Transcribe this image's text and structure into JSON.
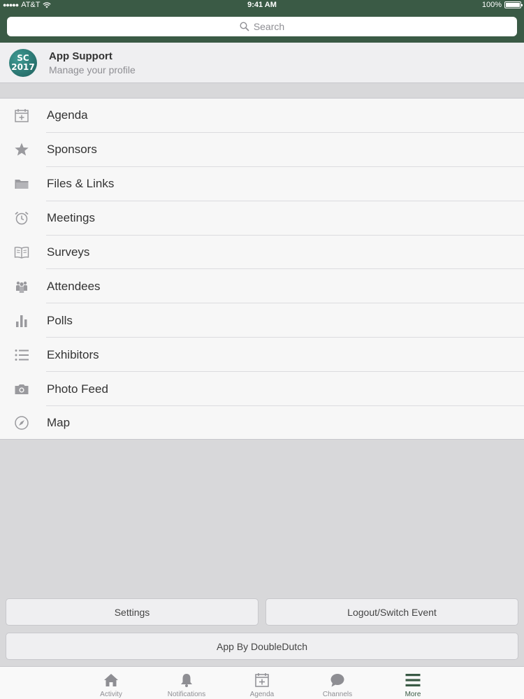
{
  "status_bar": {
    "carrier": "AT&T",
    "time": "9:41 AM",
    "battery": "100%"
  },
  "search": {
    "placeholder": "Search",
    "icon": "search-icon"
  },
  "profile": {
    "avatar_line1": "SC",
    "avatar_line2": "2017",
    "name": "App Support",
    "subtitle": "Manage your profile"
  },
  "menu": {
    "items": [
      {
        "label": "Agenda",
        "icon": "calendar-icon"
      },
      {
        "label": "Sponsors",
        "icon": "star-icon"
      },
      {
        "label": "Files & Links",
        "icon": "folder-icon"
      },
      {
        "label": "Meetings",
        "icon": "alarm-clock-icon"
      },
      {
        "label": "Surveys",
        "icon": "open-book-icon"
      },
      {
        "label": "Attendees",
        "icon": "people-icon"
      },
      {
        "label": "Polls",
        "icon": "bar-chart-icon"
      },
      {
        "label": "Exhibitors",
        "icon": "list-icon"
      },
      {
        "label": "Photo Feed",
        "icon": "camera-icon"
      },
      {
        "label": "Map",
        "icon": "compass-icon"
      }
    ]
  },
  "buttons": {
    "settings": "Settings",
    "logout": "Logout/Switch Event",
    "app_by": "App By DoubleDutch"
  },
  "tabbar": {
    "tabs": [
      {
        "label": "Activity",
        "icon": "home-icon"
      },
      {
        "label": "Notifications",
        "icon": "bell-icon"
      },
      {
        "label": "Agenda",
        "icon": "calendar-icon"
      },
      {
        "label": "Channels",
        "icon": "chat-bubble-icon"
      },
      {
        "label": "More",
        "icon": "hamburger-menu-icon"
      }
    ],
    "active": "More"
  },
  "colors": {
    "header": "#3a5a45",
    "icon_gray": "#9a9a9e",
    "background": "#d8d8da"
  }
}
